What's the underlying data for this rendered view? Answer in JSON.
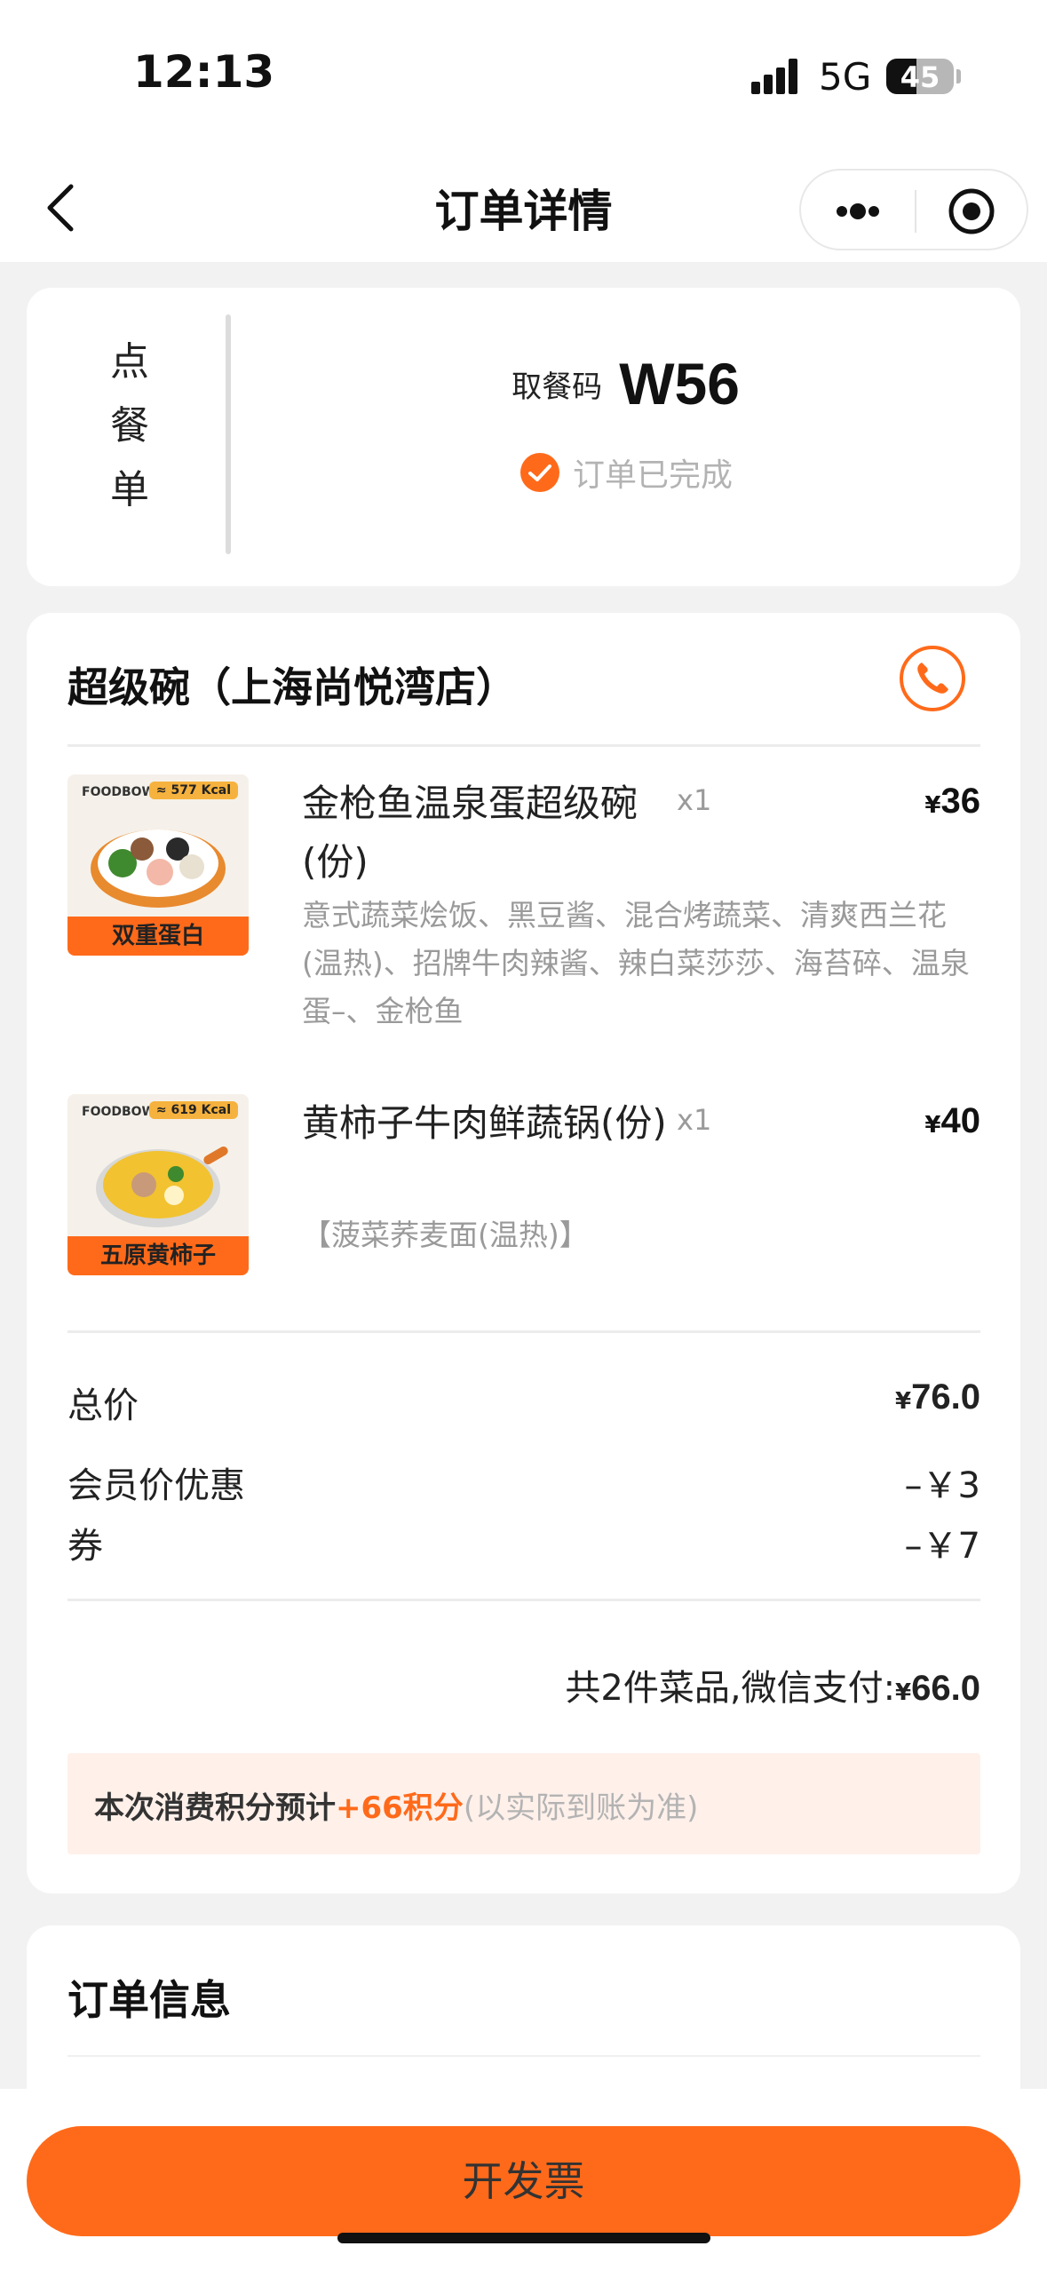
{
  "status_bar": {
    "time": "12:13",
    "network": "5G",
    "battery": "45",
    "battery_level": 0.45
  },
  "nav": {
    "title": "订单详情"
  },
  "pickup": {
    "side_label": [
      "点",
      "餐",
      "单"
    ],
    "code_label": "取餐码",
    "code": "W56",
    "status": "订单已完成"
  },
  "order": {
    "store": "超级碗（上海尚悦湾店）",
    "currency": "¥",
    "items": [
      {
        "name": "金枪鱼温泉蛋超级碗(份)",
        "qty": "x1",
        "price": "36",
        "desc": "意式蔬菜烩饭、黑豆酱、混合烤蔬菜、清爽西兰花(温热)、招牌牛肉辣酱、辣白菜莎莎、海苔碎、温泉蛋–、金枪鱼",
        "img_brand": "FOODBOWL",
        "img_kcal": "≈ 577 Kcal",
        "img_tag": "双重蛋白"
      },
      {
        "name": "黄柿子牛肉鲜蔬锅(份)",
        "qty": "x1",
        "price": "40",
        "desc": "【菠菜荞麦面(温热)】",
        "img_brand": "FOODBOWL",
        "img_kcal": "≈ 619 Kcal",
        "img_tag": "五原黄柿子"
      }
    ],
    "total_label": "总价",
    "total_value": "76.0",
    "member_label": "会员价优惠",
    "member_value": "–￥3",
    "coupon_label": "券",
    "coupon_value": "–￥7",
    "pay_label": "共2件菜品,微信支付:",
    "pay_value": "66.0",
    "points_a": "本次消费积分预计",
    "points_b": "+66积分",
    "points_c": "(以实际到账为准)"
  },
  "info": {
    "title": "订单信息"
  },
  "bottom": {
    "invoice_button": "开发票"
  },
  "colors": {
    "accent": "#ff6a1a",
    "points_bg": "#fff0ea",
    "muted": "#9a9a9a"
  }
}
